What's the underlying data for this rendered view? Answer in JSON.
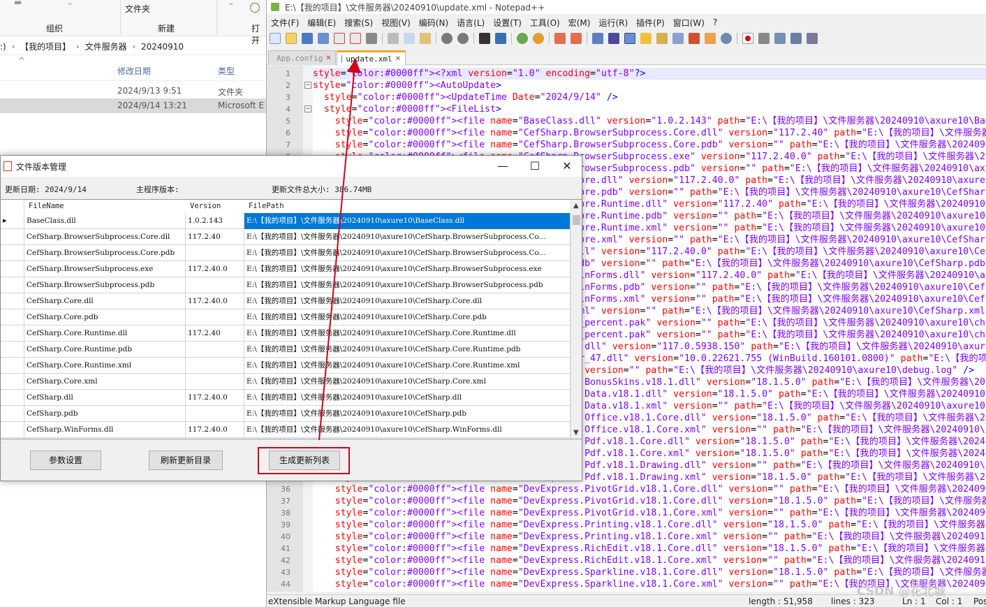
{
  "explorer": {
    "ribbon": {
      "groups": [
        "组织",
        "新建"
      ],
      "new_folder_label": "文件夹",
      "cut_label": "打开"
    },
    "breadcrumb": [
      ":)",
      "【我的项目】",
      "文件服务器",
      "20240910"
    ],
    "columns": {
      "date": "修改日期",
      "type": "类型"
    },
    "rows": [
      {
        "date": "2024/9/13 9:51",
        "type": "文件夹"
      },
      {
        "date": "2024/9/14 13:21",
        "type": "Microsoft E"
      }
    ]
  },
  "npp": {
    "title": "E:\\【我的项目】\\文件服务器\\20240910\\update.xml - Notepad++",
    "menu": [
      "文件(F)",
      "编辑(E)",
      "搜索(S)",
      "视图(V)",
      "编码(N)",
      "语言(L)",
      "设置(T)",
      "工具(O)",
      "宏(M)",
      "运行(R)",
      "插件(P)",
      "窗口(W)",
      "?"
    ],
    "tabs": [
      {
        "label": "App.config"
      },
      {
        "label": "update.xml"
      }
    ],
    "line_numbers": [
      "1",
      "2",
      "3",
      "4",
      "5",
      "6",
      "7",
      "8",
      "9",
      "10",
      "11",
      "12",
      "13",
      "14",
      "15",
      "16",
      "17",
      "18",
      "19",
      "20",
      "21",
      "22",
      "23",
      "24",
      "25",
      "26",
      "27",
      "28",
      "29",
      "30",
      "31",
      "32",
      "33",
      "34",
      "35",
      "36",
      "37",
      "38",
      "39",
      "40",
      "41",
      "42",
      "43",
      "44"
    ],
    "lines": [
      "<?xml version=\"1.0\" encoding=\"utf-8\"?>",
      "<AutoUpdate>",
      "  <UpdateTime Date=\"2024/9/14\" />",
      "  <FileList>",
      "    <file name=\"BaseClass.dll\" version=\"1.0.2.143\" path=\"E:\\【我的项目】\\文件服务器\\20240910\\axure10\\BaseClass.dll\" />",
      "    <file name=\"CefSharp.BrowserSubprocess.Core.dll\" version=\"117.2.40\" path=\"E:\\【我的项目】\\文件服务器\\20240910\\axure1",
      "    <file name=\"CefSharp.BrowserSubprocess.Core.pdb\" version=\"\" path=\"E:\\【我的项目】\\文件服务器\\20240910\\axure10\\CefSh",
      "    <file name=\"CefSharp.BrowserSubprocess.exe\" version=\"117.2.40.0\" path=\"E:\\【我的项目】\\文件服务器\\20240910\\axure10\\C",
      "    <file name=\"CefSharp.BrowserSubprocess.pdb\" version=\"\" path=\"E:\\【我的项目】\\文件服务器\\20240910\\axure10\\CefSharp.Br",
      "    <file name=\"CefSharp.Core.dll\" version=\"117.2.40.0\" path=\"E:\\【我的项目】\\文件服务器\\20240910\\axure10\\CefSharp.Core",
      "    <file name=\"CefSharp.Core.pdb\" version=\"\" path=\"E:\\【我的项目】\\文件服务器\\20240910\\axure10\\CefSharp.Core.pdb\" />",
      "    <file name=\"CefSharp.Core.Runtime.dll\" version=\"117.2.40\" path=\"E:\\【我的项目】\\文件服务器\\20240910\\axure10\\CefSharp",
      "    <file name=\"CefSharp.Core.Runtime.pdb\" version=\"\" path=\"E:\\【我的项目】\\文件服务器\\20240910\\axure10\\CefSharp.Core.Ru",
      "    <file name=\"CefSharp.Core.Runtime.xml\" version=\"\" path=\"E:\\【我的项目】\\文件服务器\\20240910\\axure10\\CefSharp.Core.Ru",
      "    <file name=\"CefSharp.Core.xml\" version=\"\" path=\"E:\\【我的项目】\\文件服务器\\20240910\\axure10\\CefSharp.Core.xml\" />",
      "    <file name=\"CefSharp.dll\" version=\"117.2.40.0\" path=\"E:\\【我的项目】\\文件服务器\\20240910\\axure10\\CefSharp.dll\" />",
      "    <file name=\"CefSharp.pdb\" version=\"\" path=\"E:\\【我的项目】\\文件服务器\\20240910\\axure10\\CefSharp.pdb\" />",
      "    <file name=\"CefSharp.WinForms.dll\" version=\"117.2.40.0\" path=\"E:\\【我的项目】\\文件服务器\\20240910\\axure10\\CefSharp.W",
      "    <file name=\"CefSharp.WinForms.pdb\" version=\"\" path=\"E:\\【我的项目】\\文件服务器\\20240910\\axure10\\CefSharp.WinForms.pd",
      "    <file name=\"CefSharp.WinForms.xml\" version=\"\" path=\"E:\\【我的项目】\\文件服务器\\20240910\\axure10\\CefSharp.WinForms.xm",
      "    <file name=\"CefSharp.xml\" version=\"\" path=\"E:\\【我的项目】\\文件服务器\\20240910\\axure10\\CefSharp.xml\" />",
      "    <file name=\"chrome_100_percent.pak\" version=\"\" path=\"E:\\【我的项目】\\文件服务器\\20240910\\axure10\\chrome_100_percent",
      "    <file name=\"chrome_200_percent.pak\" version=\"\" path=\"E:\\【我的项目】\\文件服务器\\20240910\\axure10\\chrome_200_percent",
      "    <file name=\"chrome_elf.dll\" version=\"117.0.5938.150\" path=\"E:\\【我的项目】\\文件服务器\\20240910\\axure10\\chrome_elf.dll",
      "    <file name=\"d3dcompiler_47.dll\" version=\"10.0.22621.755 (WinBuild.160101.0800)\" path=\"E:\\【我的项目】\\文件服务器\\202",
      "    <file name=\"debug.log\" version=\"\" path=\"E:\\【我的项目】\\文件服务器\\20240910\\axure10\\debug.log\" />",
      "    <file name=\"DevExpress.BonusSkins.v18.1.dll\" version=\"18.1.5.0\" path=\"E:\\【我的项目】\\文件服务器\\20240910\\axure10\\D",
      "    <file name=\"DevExpress.Data.v18.1.dll\" version=\"18.1.5.0\" path=\"E:\\【我的项目】\\文件服务器\\20240910\\axure10\\DevExpre",
      "    <file name=\"DevExpress.Data.v18.1.xml\" version=\"\" path=\"E:\\【我的项目】\\文件服务器\\20240910\\axure10\\DevExpress.Data",
      "    <file name=\"DevExpress.Office.v18.1.Core.dll\" version=\"18.1.5.0\" path=\"E:\\【我的项目】\\文件服务器\\20240910\\axure10\\",
      "    <file name=\"DevExpress.Office.v18.1.Core.xml\" version=\"\" path=\"E:\\【我的项目】\\文件服务器\\20240910\\axure10\\DevExpre",
      "    <file name=\"DevExpress.Pdf.v18.1.Core.dll\" version=\"18.1.5.0\" path=\"E:\\【我的项目】\\文件服务器\\20240910\\axure10\\DevExp",
      "    <file name=\"DevExpress.Pdf.v18.1.Core.xml\" version=\"18.1.5.0\" path=\"E:\\【我的项目】\\文件服务器\\20240910\\axure10\\D",
      "    <file name=\"DevExpress.Pdf.v18.1.Drawing.dll\" version=\"\" path=\"E:\\【我的项目】\\文件服务器\\20240910\\axure10\\DevExpres",
      "    <file name=\"DevExpress.Pdf.v18.1.Drawing.xml\" version=\"18.1.5.0\" path=\"E:\\【我的项目】\\文件服务器\\20240910\\axure10\\Dev",
      "    <file name=\"DevExpress.PivotGrid.v18.1.Core.dll\" version=\"\" path=\"E:\\【我的项目】\\文件服务器\\20240910\\axure10\\DevExpress.",
      "    <file name=\"DevExpress.PivotGrid.v18.1.Core.dll\" version=\"18.1.5.0\" path=\"E:\\【我的项目】\\文件服务器\\20240910\\axure1",
      "    <file name=\"DevExpress.PivotGrid.v18.1.Core.xml\" version=\"\" path=\"E:\\【我的项目】\\文件服务器\\20240910\\axure10\\DevExp",
      "    <file name=\"DevExpress.Printing.v18.1.Core.dll\" version=\"18.1.5.0\" path=\"E:\\【我的项目】\\文件服务器\\20240910\\axure10",
      "    <file name=\"DevExpress.Printing.v18.1.Core.xml\" version=\"\" path=\"E:\\【我的项目】\\文件服务器\\20240910\\axure10\\DevExp",
      "    <file name=\"DevExpress.RichEdit.v18.1.Core.dll\" version=\"18.1.5.0\" path=\"E:\\【我的项目】\\文件服务器\\20240910\\axure10",
      "    <file name=\"DevExpress.RichEdit.v18.1.Core.xml\" version=\"\" path=\"E:\\【我的项目】\\文件服务器\\20240910\\axure10\\DevExp",
      "    <file name=\"DevExpress.Sparkline.v18.1.Core.dll\" version=\"18.1.5.0\" path=\"E:\\【我的项目】\\文件服务器\\20240910\\axure1",
      "    <file name=\"DevExpress.Sparkline.v18.1.Core.xml\" version=\"\" path=\"E:\\【我的项目】\\文件服务器\\20240910\\axure10\\DevExp",
      "    <file name=\"DevExpress.Utils.v18.1.dll\" version=\"18.1.5.0\" path=\"E:\\【我的项目】\\文件服务器\\20240910\\axure10\\DevExp"
    ],
    "status": {
      "language": "eXtensible Markup Language file",
      "length": "length : 51,958",
      "lines": "lines : 323",
      "ln": "Ln : 1",
      "col": "Col : 1",
      "pos": "Pos",
      "watermark": "CSDN @花北城"
    }
  },
  "dialog": {
    "title": "文件版本管理",
    "update_date": "更新日期: 2024/9/14",
    "main_version": "主程序版本:",
    "total_size": "更新文件总大小: 386.74MB",
    "columns": {
      "filename": "FileName",
      "version": "Version",
      "filepath": "FilePath"
    },
    "rows": [
      {
        "name": "BaseClass.dll",
        "version": "1.0.2.143",
        "path": "E:\\【我的项目】\\文件服务器\\20240910\\axure10\\BaseClass.dll"
      },
      {
        "name": "CefSharp.BrowserSubprocess.Core.dll",
        "version": "117.2.40",
        "path": "E:\\【我的项目】\\文件服务器\\20240910\\axure10\\CefSharp.BrowserSubprocess.Co..."
      },
      {
        "name": "CefSharp.BrowserSubprocess.Core.pdb",
        "version": "",
        "path": "E:\\【我的项目】\\文件服务器\\20240910\\axure10\\CefSharp.BrowserSubprocess.Co..."
      },
      {
        "name": "CefSharp.BrowserSubprocess.exe",
        "version": "117.2.40.0",
        "path": "E:\\【我的项目】\\文件服务器\\20240910\\axure10\\CefSharp.BrowserSubprocess.exe"
      },
      {
        "name": "CefSharp.BrowserSubprocess.pdb",
        "version": "",
        "path": "E:\\【我的项目】\\文件服务器\\20240910\\axure10\\CefSharp.BrowserSubprocess.pdb"
      },
      {
        "name": "CefSharp.Core.dll",
        "version": "117.2.40.0",
        "path": "E:\\【我的项目】\\文件服务器\\20240910\\axure10\\CefSharp.Core.dll"
      },
      {
        "name": "CefSharp.Core.pdb",
        "version": "",
        "path": "E:\\【我的项目】\\文件服务器\\20240910\\axure10\\CefSharp.Core.pdb"
      },
      {
        "name": "CefSharp.Core.Runtime.dll",
        "version": "117.2.40",
        "path": "E:\\【我的项目】\\文件服务器\\20240910\\axure10\\CefSharp.Core.Runtime.dll"
      },
      {
        "name": "CefSharp.Core.Runtime.pdb",
        "version": "",
        "path": "E:\\【我的项目】\\文件服务器\\20240910\\axure10\\CefSharp.Core.Runtime.pdb"
      },
      {
        "name": "CefSharp.Core.Runtime.xml",
        "version": "",
        "path": "E:\\【我的项目】\\文件服务器\\20240910\\axure10\\CefSharp.Core.Runtime.xml"
      },
      {
        "name": "CefSharp.Core.xml",
        "version": "",
        "path": "E:\\【我的项目】\\文件服务器\\20240910\\axure10\\CefSharp.Core.xml"
      },
      {
        "name": "CefSharp.dll",
        "version": "117.2.40.0",
        "path": "E:\\【我的项目】\\文件服务器\\20240910\\axure10\\CefSharp.dll"
      },
      {
        "name": "CefSharp.pdb",
        "version": "",
        "path": "E:\\【我的项目】\\文件服务器\\20240910\\axure10\\CefSharp.pdb"
      },
      {
        "name": "CefSharp.WinForms.dll",
        "version": "117.2.40.0",
        "path": "E:\\【我的项目】\\文件服务器\\20240910\\axure10\\CefSharp.WinForms.dll"
      }
    ],
    "buttons": {
      "params": "参数设置",
      "refresh": "刷新更新目录",
      "generate": "生成更新列表"
    },
    "selected_row": 0
  },
  "colors": {
    "annotation": "#d0021b",
    "selection": "#0078d7",
    "xml_tag": "#0000ff",
    "xml_attr": "#ff0000",
    "xml_value": "#8000ff"
  }
}
